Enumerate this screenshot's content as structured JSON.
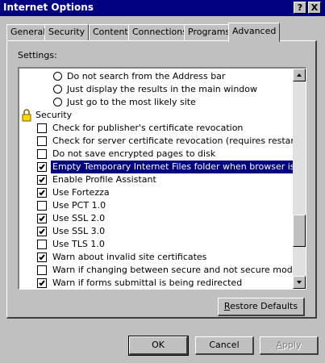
{
  "window": {
    "title": "Internet Options",
    "help_button": "?",
    "close_button": "X"
  },
  "tabs": [
    {
      "label": "General"
    },
    {
      "label": "Security"
    },
    {
      "label": "Content"
    },
    {
      "label": "Connections"
    },
    {
      "label": "Programs"
    },
    {
      "label": "Advanced",
      "active": true
    }
  ],
  "settings_label": "Settings:",
  "items": [
    {
      "type": "radio",
      "label": "Do not search from the Address bar",
      "checked": false
    },
    {
      "type": "radio",
      "label": "Just display the results in the main window",
      "checked": false
    },
    {
      "type": "radio",
      "label": "Just go to the most likely site",
      "checked": false
    },
    {
      "type": "category",
      "label": "Security",
      "icon": "lock-icon"
    },
    {
      "type": "checkbox",
      "label": "Check for publisher's certificate revocation",
      "checked": false
    },
    {
      "type": "checkbox",
      "label": "Check for server certificate revocation (requires restart)",
      "checked": false
    },
    {
      "type": "checkbox",
      "label": "Do not save encrypted pages to disk",
      "checked": false
    },
    {
      "type": "checkbox",
      "label": "Empty Temporary Internet Files folder when browser is closed",
      "checked": true,
      "selected": true
    },
    {
      "type": "checkbox",
      "label": "Enable Profile Assistant",
      "checked": true
    },
    {
      "type": "checkbox",
      "label": "Use Fortezza",
      "checked": true
    },
    {
      "type": "checkbox",
      "label": "Use PCT 1.0",
      "checked": false
    },
    {
      "type": "checkbox",
      "label": "Use SSL 2.0",
      "checked": true
    },
    {
      "type": "checkbox",
      "label": "Use SSL 3.0",
      "checked": true
    },
    {
      "type": "checkbox",
      "label": "Use TLS 1.0",
      "checked": false
    },
    {
      "type": "checkbox",
      "label": "Warn about invalid site certificates",
      "checked": true
    },
    {
      "type": "checkbox",
      "label": "Warn if changing between secure and not secure mode",
      "checked": false
    },
    {
      "type": "checkbox",
      "label": "Warn if forms submittal is being redirected",
      "checked": true
    }
  ],
  "buttons": {
    "restore_defaults": {
      "label": "Restore Defaults",
      "accel": "R",
      "rest": "estore Defaults"
    },
    "ok": {
      "label": "OK"
    },
    "cancel": {
      "label": "Cancel"
    },
    "apply": {
      "label": "Apply",
      "accel": "A",
      "rest": "pply",
      "disabled": true
    }
  },
  "scroll": {
    "position": 0.82
  }
}
